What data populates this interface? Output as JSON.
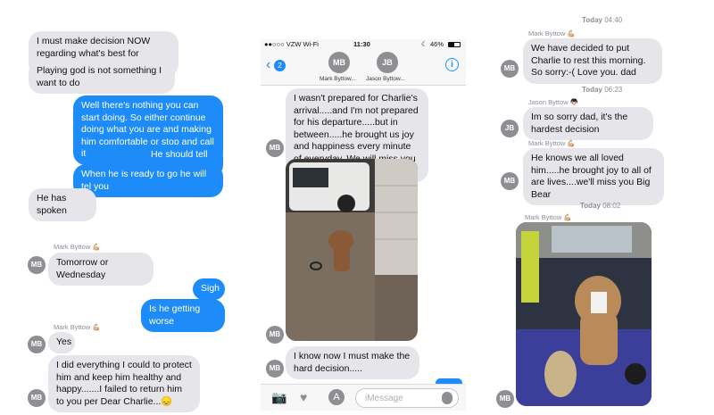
{
  "left": {
    "messages": [
      {
        "text": "I must make decision NOW regarding what's best for Charlie."
      },
      {
        "text": "Playing god is not something I want to do"
      },
      {
        "text": "Well there's nothing you can start doing. So either continue doing what you are and making him comfortable or stop and call it"
      },
      {
        "text": "He should tell you"
      },
      {
        "text": "When he is ready to go he will tel you"
      },
      {
        "text": "He has spoken"
      },
      {
        "text": "Tomorrow or Wednesday"
      },
      {
        "text": "Sigh"
      },
      {
        "text": "Is he getting worse"
      },
      {
        "text": "Yes"
      },
      {
        "text": "I did everything I could to protect him and keep him healthy and happy.......I failed to return him to you per Dear Charlie...😞"
      }
    ],
    "sender_1": "Mark Byttow 💪🏼",
    "sender_2": "Mark Byttow 💪🏼",
    "avatar": "MB"
  },
  "mid": {
    "status": {
      "carrier": "●●○○○ VZW Wi-Fi",
      "time": "11:30",
      "battery": "46%"
    },
    "nav": {
      "back_badge": "2",
      "contact_1": "Mark Byttow...",
      "contact_2": "Jason Byttow...",
      "av1": "MB",
      "av2": "JB"
    },
    "messages": [
      {
        "text": "I wasn't prepared for Charlie's arrival.....and I'm not prepared for his departure.....but in between.....he brought us joy and happiness every minute of everyday. We will miss you Charlie 🐻 ----😞"
      },
      {
        "text": "I know now I must make the hard decision....."
      }
    ],
    "avatar": "MB",
    "composer_placeholder": "iMessage"
  },
  "right": {
    "stamps": [
      {
        "day": "Today",
        "time": "04:40"
      },
      {
        "day": "Today",
        "time": "06:23"
      },
      {
        "day": "Today",
        "time": "08:02"
      }
    ],
    "senders": [
      "Mark Byttow 💪🏼",
      "Jason Byttow 👦🏻",
      "Mark Byttow 💪🏼",
      "Mark Byttow 💪🏼"
    ],
    "messages": [
      {
        "text": "We have decided to put Charlie to rest this morning. So sorry:-( Love you. dad"
      },
      {
        "text": "Im so sorry dad, it's the hardest decision"
      },
      {
        "text": "He knows we all loved him.....he brought joy to all of are lives....we'll miss you Big Bear"
      }
    ],
    "avatars": [
      "MB",
      "JB",
      "MB",
      "MB"
    ]
  },
  "colors": {
    "blue": "#1d8cf8",
    "gray": "#e5e5ea"
  }
}
